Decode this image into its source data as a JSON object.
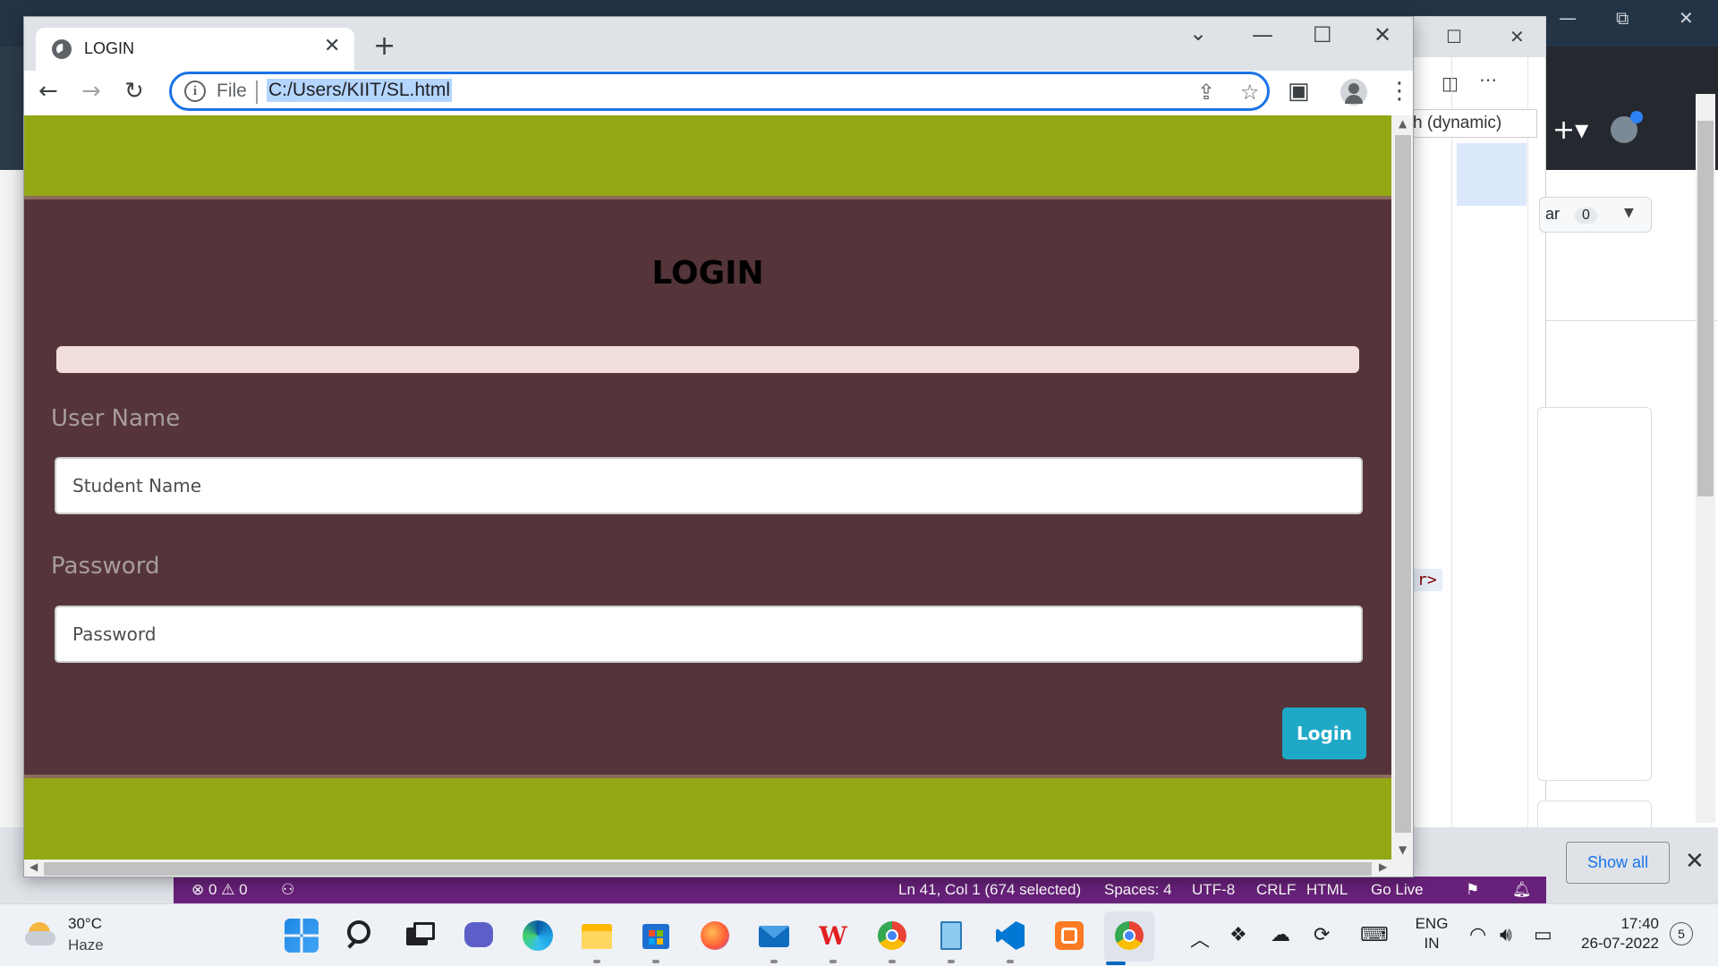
{
  "browser": {
    "tab_title": "LOGIN",
    "omnibox": {
      "scheme_label": "File",
      "url": "C:/Users/KIIT/SL.html"
    }
  },
  "page": {
    "heading": "LOGIN",
    "username": {
      "label": "User Name",
      "placeholder": "Student Name"
    },
    "password": {
      "label": "Password",
      "placeholder": "Password"
    },
    "login_button": "Login"
  },
  "background": {
    "vscode_dropdown": "h (dynamic)",
    "vscode_code_fragment": "r>",
    "github_star_label": "ar",
    "github_star_count": "0",
    "download_bar_show_all": "Show all"
  },
  "vscode_status": {
    "problems": "⊗ 0 ⚠ 0",
    "cursor": "Ln 41, Col 1 (674 selected)",
    "spaces": "Spaces: 4",
    "encoding": "UTF-8",
    "eol": "CRLF",
    "language": "HTML",
    "golive": "Go Live"
  },
  "taskbar": {
    "weather_temp": "30°C",
    "weather_condition": "Haze",
    "language_line1": "ENG",
    "language_line2": "IN",
    "time": "17:40",
    "date": "26-07-2022",
    "notifications": "5"
  },
  "colors": {
    "page_background": "#94a815",
    "card_background": "#553539",
    "login_button": "#20a9c7",
    "alert_bar": "#f3dede",
    "vscode_status": "#68217a"
  }
}
